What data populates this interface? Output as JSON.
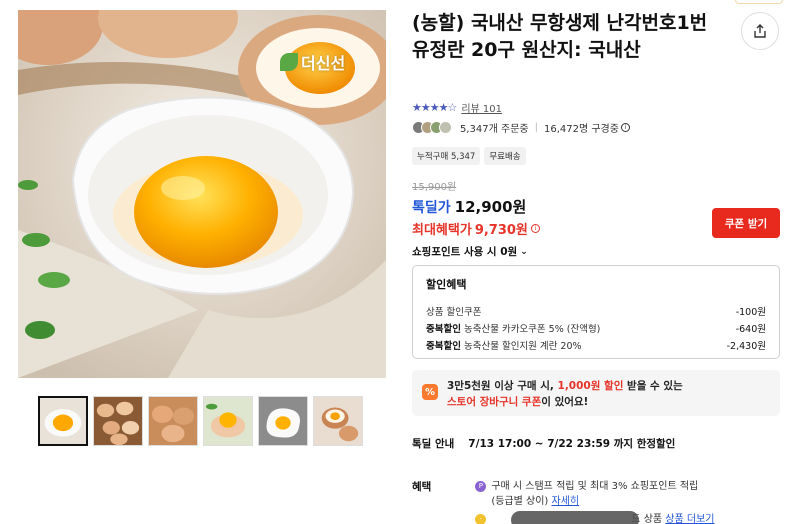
{
  "gallery": {
    "brand_logo_text": "더신선",
    "thumbnails": [
      "egg-yolk-bowl",
      "eggs-basket",
      "eggs-group",
      "egg-yolk-hand",
      "fried-egg",
      "eggs-cracked"
    ]
  },
  "product": {
    "title": "(농할) 국내산 무항생제 난각번호1번 유정란 20구 원산지: 국내산",
    "rating_stars": "★★★★☆",
    "review_label": "리뷰 101",
    "orders_count": "5,347개 주문중",
    "subscribers": "16,472명 구경중",
    "tags": [
      "누적구매 5,347",
      "무료배송"
    ]
  },
  "price": {
    "original": "15,900원",
    "deal_label": "톡딜가",
    "deal_price": "12,900원",
    "max_benefit_label": "최대혜택가",
    "max_benefit_price": "9,730원",
    "coupon_button": "쿠폰 받기",
    "points_label": "쇼핑포인트 사용 시 0원"
  },
  "discount": {
    "title": "할인혜택",
    "rows": [
      {
        "prefix": "",
        "label": "상품 할인쿠폰",
        "amount": "-100원"
      },
      {
        "prefix": "중복할인",
        "label": "농축산물 카카오쿠폰 5% (잔액형)",
        "amount": "-640원"
      },
      {
        "prefix": "중복할인",
        "label": "농축산물 할인지원 계란 20%",
        "amount": "-2,430원"
      }
    ]
  },
  "promo": {
    "line1_a": "3만5천원 이상 구매 시, ",
    "line1_b": "1,000원 할인",
    "line1_c": " 받을 수 있는",
    "line2_a": "스토어 장바구니 쿠폰",
    "line2_b": "이 있어요!"
  },
  "deal_info": {
    "label": "톡딜 안내",
    "value": "7/13 17:00 ~ 7/22 23:59 까지 한정할인"
  },
  "benefits": {
    "label": "혜택",
    "item1_a": "구매 시 스탬프 적립 및 최대 3% 쇼핑포인트 적립",
    "item1_b": "(등급별 상이) ",
    "item1_link": "자세히",
    "item2_a": "",
    "item2_b": "드 상품 ",
    "item2_link": "상품 더보기"
  },
  "colors": {
    "accent_blue": "#2156d8",
    "accent_red": "#e5342a",
    "coupon_red": "#e8291e"
  }
}
